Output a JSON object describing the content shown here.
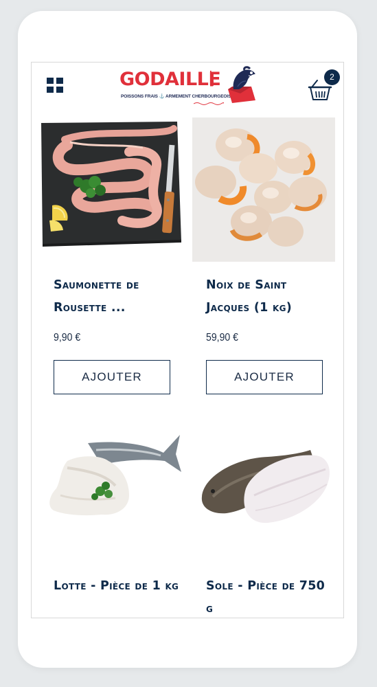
{
  "header": {
    "logo_name": "GODAILLE",
    "logo_com": ".com",
    "logo_tagline": "POISSONS FRAIS ⚓ ARMEMENT CHERBOURGEOIS",
    "cart_count": "2"
  },
  "products": [
    {
      "title": "Saumonette de Rousette ...",
      "price": "9,90 €",
      "button": "AJOUTER"
    },
    {
      "title": "Noix de Saint Jacques (1 kg)",
      "price": "59,90 €",
      "button": "AJOUTER"
    },
    {
      "title": "Lotte - Pièce de 1 kg"
    },
    {
      "title": "Sole - Pièce de 750 g"
    }
  ],
  "colors": {
    "navy": "#0e2a4a",
    "brand_red": "#e0303a"
  },
  "icons": [
    "grid-menu-icon",
    "fish-logo-icon",
    "basket-icon"
  ]
}
